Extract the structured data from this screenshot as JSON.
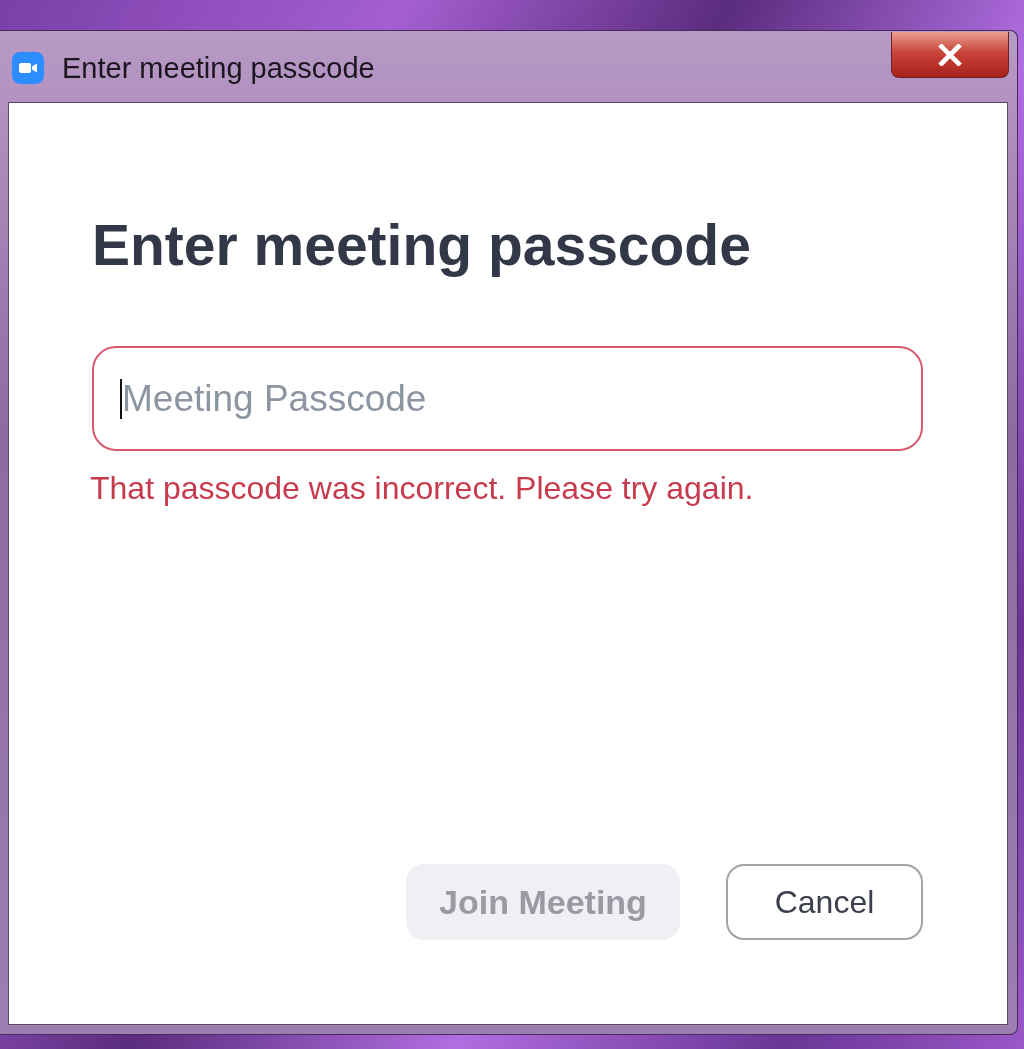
{
  "window": {
    "title": "Enter meeting passcode"
  },
  "dialog": {
    "heading": "Enter meeting passcode",
    "passcode_field": {
      "placeholder": "Meeting Passcode",
      "focused": true,
      "error": true
    },
    "error_message": "That passcode was incorrect. Please try again.",
    "buttons": [
      {
        "label": "Join Meeting",
        "kind": "primary",
        "disabled": true
      },
      {
        "label": "Cancel",
        "kind": "secondary",
        "disabled": false
      }
    ]
  }
}
